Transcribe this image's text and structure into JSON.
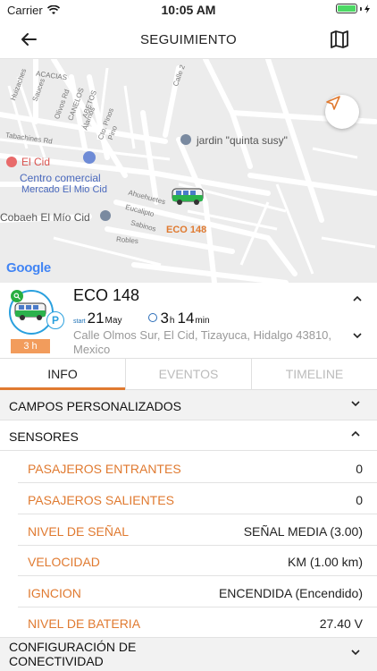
{
  "status_bar": {
    "carrier": "Carrier",
    "time": "10:05 AM"
  },
  "nav": {
    "title": "SEGUIMIENTO"
  },
  "map": {
    "street_labels": [
      "ACACIAS",
      "Huizaches",
      "Sauces",
      "Olivos Rd",
      "CANELOS",
      "ABETOS",
      "Álamos",
      "Cto. Pinos",
      "Pino",
      "Calle 2",
      "Tabachines Rd",
      "Ahuehuetes",
      "Eucalipto",
      "Sabinos",
      "Robles"
    ],
    "poi_garden": "jardin \"quinta susy\"",
    "poi_cid": "El Cid",
    "poi_mall_line1": "Centro comercial",
    "poi_mall_line2": "Mercado El Mio Cid",
    "poi_school": "Cobaeh El Mío Cid",
    "vehicle_label": "ECO 148",
    "attribution": "Google"
  },
  "vehicle": {
    "name": "ECO 148",
    "start_label": "start",
    "start_day": "21",
    "start_month": "May",
    "duration_hours": "3",
    "hours_unit": "h",
    "duration_minutes": "14",
    "minutes_unit": "min",
    "address": "Calle Olmos Sur, El Cid, Tizayuca, Hidalgo 43810, Mexico",
    "time_badge": "3 h",
    "parking_badge": "P"
  },
  "tabs": [
    {
      "label": "INFO",
      "active": true
    },
    {
      "label": "EVENTOS",
      "active": false
    },
    {
      "label": "TIMELINE",
      "active": false
    }
  ],
  "sections": {
    "custom_fields": "CAMPOS PERSONALIZADOS",
    "sensors": "SENSORES",
    "connectivity": "CONFIGURACIÓN DE CONECTIVIDAD"
  },
  "sensors": [
    {
      "name": "PASAJEROS ENTRANTES",
      "value": "0"
    },
    {
      "name": "PASAJEROS SALIENTES",
      "value": "0"
    },
    {
      "name": "NIVEL DE SEÑAL",
      "value": "SEÑAL MEDIA (3.00)"
    },
    {
      "name": "VELOCIDAD",
      "value": "KM (1.00 km)"
    },
    {
      "name": "IGNCION",
      "value": "ENCENDIDA (Encendido)"
    },
    {
      "name": "NIVEL DE BATERIA",
      "value": "27.40 V"
    }
  ],
  "colors": {
    "accent": "#e07a30",
    "brand_blue": "#2aa0de",
    "status_green": "#27ae3f"
  }
}
